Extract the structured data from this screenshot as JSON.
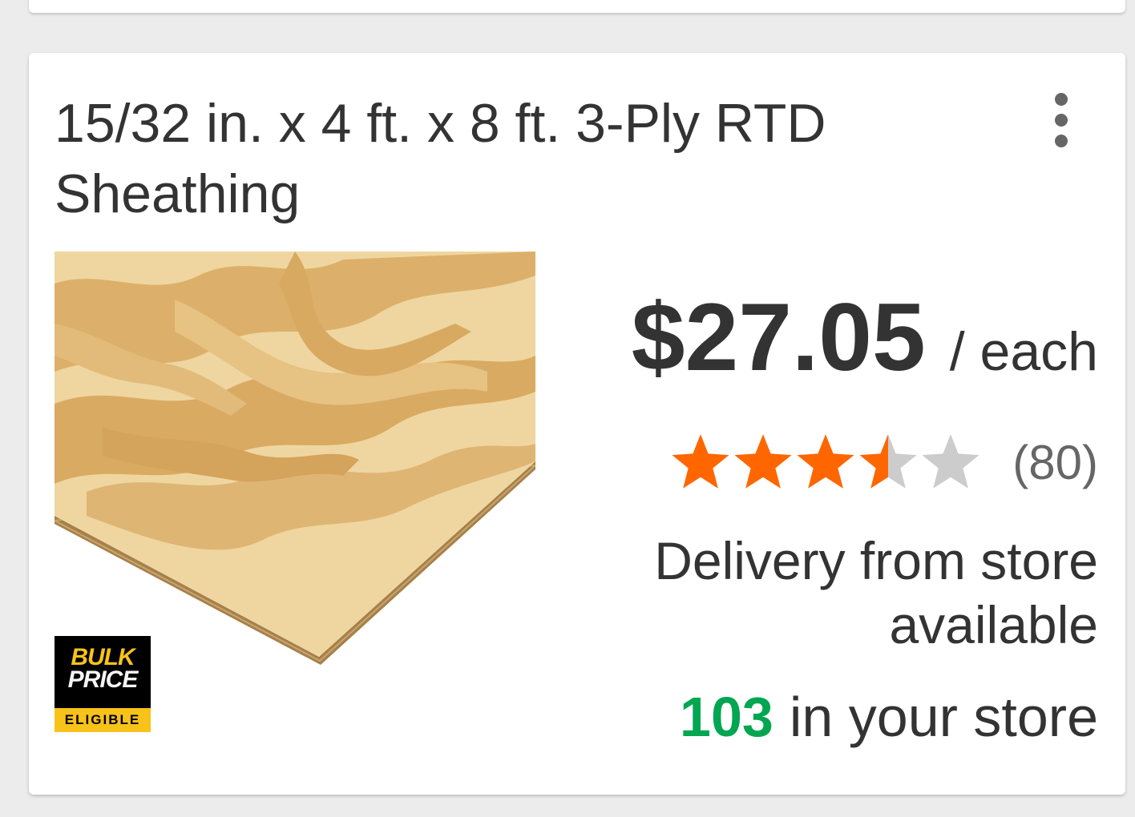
{
  "product": {
    "title": "15/32 in. x 4 ft. x 8 ft. 3-Ply RTD Sheathing",
    "price": "$27.05",
    "unit": "/ each",
    "rating": 3.5,
    "rating_max": 5,
    "review_count": "(80)",
    "delivery_text": "Delivery from store available",
    "stock_count": "103",
    "stock_text": "in your store",
    "image_icon": "plywood-sheet-image"
  },
  "badge": {
    "line1": "BULK",
    "line2": "PRICE",
    "line3": "ELIGIBLE"
  },
  "menu": {
    "icon": "more-vertical-icon"
  },
  "colors": {
    "star_filled": "#ff6600",
    "star_empty": "#cccccc",
    "stock_green": "#00a650",
    "badge_yellow": "#f7c21a",
    "text": "#333333"
  }
}
